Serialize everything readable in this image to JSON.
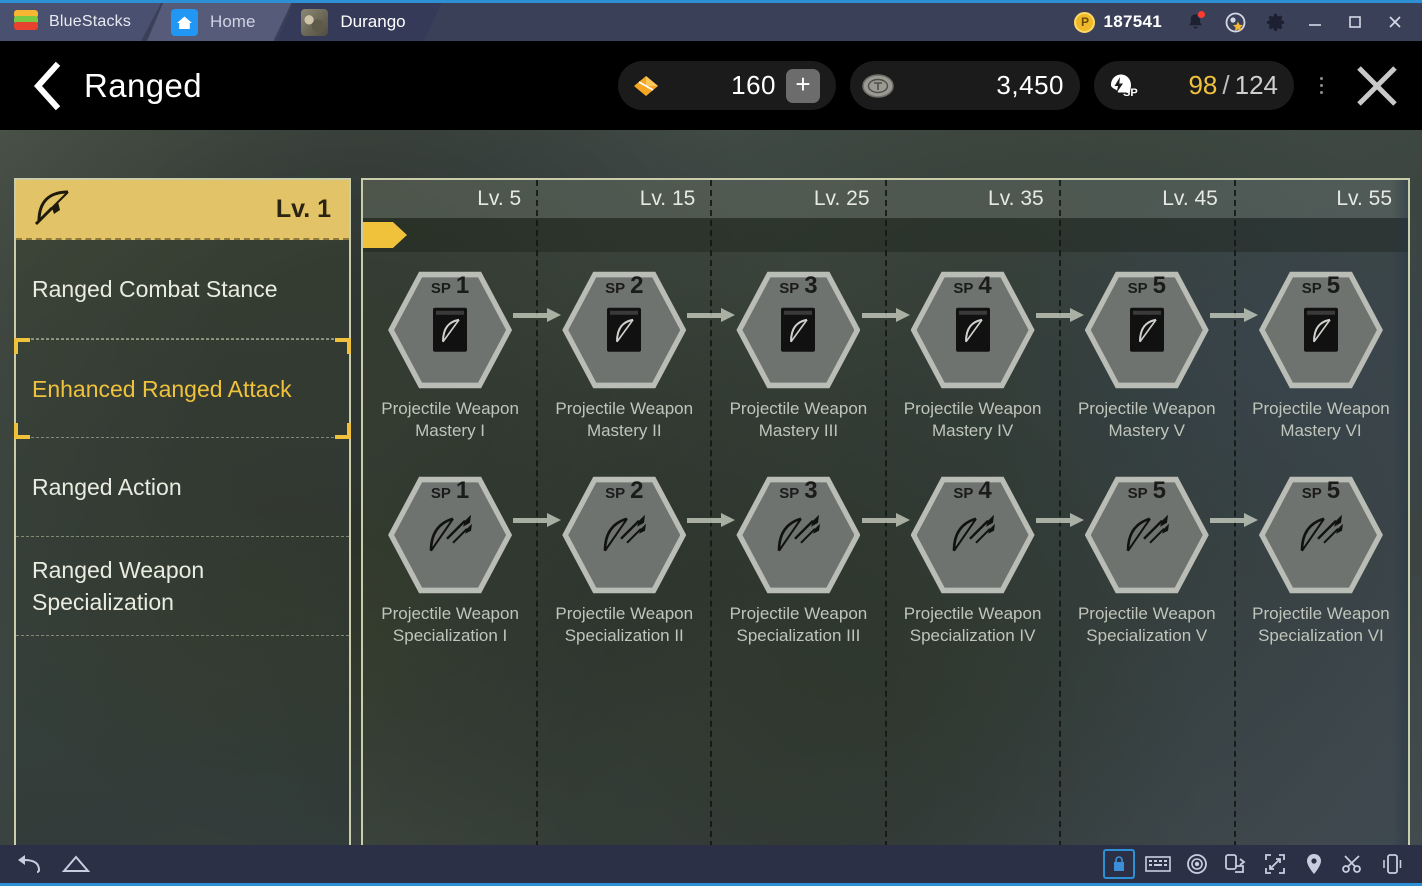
{
  "window": {
    "brand": "BlueStacks",
    "tabs": [
      {
        "label": "Home",
        "icon": "home-icon",
        "active": false
      },
      {
        "label": "Durango",
        "icon": "game-thumbnail-icon",
        "active": true
      }
    ],
    "points_value": "187541",
    "points_icon": "bluestacks-points-coin-icon",
    "controls": [
      {
        "name": "notifications-icon",
        "label": ""
      },
      {
        "name": "star-badge-icon",
        "label": ""
      },
      {
        "name": "settings-gear-icon",
        "label": ""
      },
      {
        "name": "minimize-icon",
        "label": ""
      },
      {
        "name": "maximize-icon",
        "label": ""
      },
      {
        "name": "close-window-icon",
        "label": ""
      }
    ]
  },
  "game_header": {
    "back_icon": "back-chevron-icon",
    "title": "Ranged",
    "resources": [
      {
        "id": "gem",
        "icon": "orange-gem-icon",
        "value": "160",
        "plus_label": "+"
      },
      {
        "id": "coin",
        "icon": "stone-coin-icon",
        "value": "3,450"
      }
    ],
    "skill_points": {
      "icon": "sp-head-icon",
      "current": "98",
      "separator": "/",
      "max": "124"
    },
    "overflow_icon": "more-options-icon",
    "close_label": "close-panel-icon"
  },
  "sidebar": {
    "header": {
      "icon": "bow-icon",
      "level": "Lv. 1",
      "accent": "#e2c367"
    },
    "items": [
      {
        "label": "Ranged Combat Stance",
        "selected": false
      },
      {
        "label": "Enhanced Ranged Attack",
        "selected": true
      },
      {
        "label": "Ranged Action",
        "selected": false
      },
      {
        "label": "Ranged Weapon Specialization",
        "selected": false
      }
    ]
  },
  "tree": {
    "level_columns": [
      "Lv. 5",
      "Lv. 15",
      "Lv. 25",
      "Lv. 35",
      "Lv. 45",
      "Lv. 55"
    ],
    "progress_marker": "current-level-marker",
    "rows": [
      {
        "id": "projectile-weapon-mastery",
        "icon": "skill-book-bow-icon",
        "nodes": [
          {
            "sp_label": "SP",
            "sp_cost": "1",
            "name": "Projectile Weapon Mastery I"
          },
          {
            "sp_label": "SP",
            "sp_cost": "2",
            "name": "Projectile Weapon Mastery II"
          },
          {
            "sp_label": "SP",
            "sp_cost": "3",
            "name": "Projectile Weapon Mastery III"
          },
          {
            "sp_label": "SP",
            "sp_cost": "4",
            "name": "Projectile Weapon Mastery IV"
          },
          {
            "sp_label": "SP",
            "sp_cost": "5",
            "name": "Projectile Weapon Mastery V"
          },
          {
            "sp_label": "SP",
            "sp_cost": "5",
            "name": "Projectile Weapon Mastery VI"
          }
        ]
      },
      {
        "id": "projectile-weapon-specialization",
        "icon": "bow-arrows-icon",
        "nodes": [
          {
            "sp_label": "SP",
            "sp_cost": "1",
            "name": "Projectile Weapon Specialization I"
          },
          {
            "sp_label": "SP",
            "sp_cost": "2",
            "name": "Projectile Weapon Specialization II"
          },
          {
            "sp_label": "SP",
            "sp_cost": "3",
            "name": "Projectile Weapon Specialization III"
          },
          {
            "sp_label": "SP",
            "sp_cost": "4",
            "name": "Projectile Weapon Specialization IV"
          },
          {
            "sp_label": "SP",
            "sp_cost": "5",
            "name": "Projectile Weapon Specialization V"
          },
          {
            "sp_label": "SP",
            "sp_cost": "5",
            "name": "Projectile Weapon Specialization VI"
          }
        ]
      }
    ]
  },
  "taskbar": {
    "left": [
      {
        "name": "android-back-icon"
      },
      {
        "name": "android-home-icon"
      }
    ],
    "right": [
      {
        "name": "app-lock-icon",
        "boxed": true
      },
      {
        "name": "keyboard-controls-icon",
        "boxed": false
      },
      {
        "name": "eye-macro-icon",
        "boxed": false
      },
      {
        "name": "rotate-screen-icon",
        "boxed": false
      },
      {
        "name": "fullscreen-icon",
        "boxed": false
      },
      {
        "name": "location-pin-icon",
        "boxed": false
      },
      {
        "name": "scissors-screenshot-icon",
        "boxed": false
      },
      {
        "name": "shake-device-icon",
        "boxed": false
      }
    ]
  },
  "colors": {
    "accent_blue": "#2d8fd4",
    "gold": "#f0c23c",
    "sidebar_header": "#e2c367",
    "titlebar": "#3b4059"
  }
}
